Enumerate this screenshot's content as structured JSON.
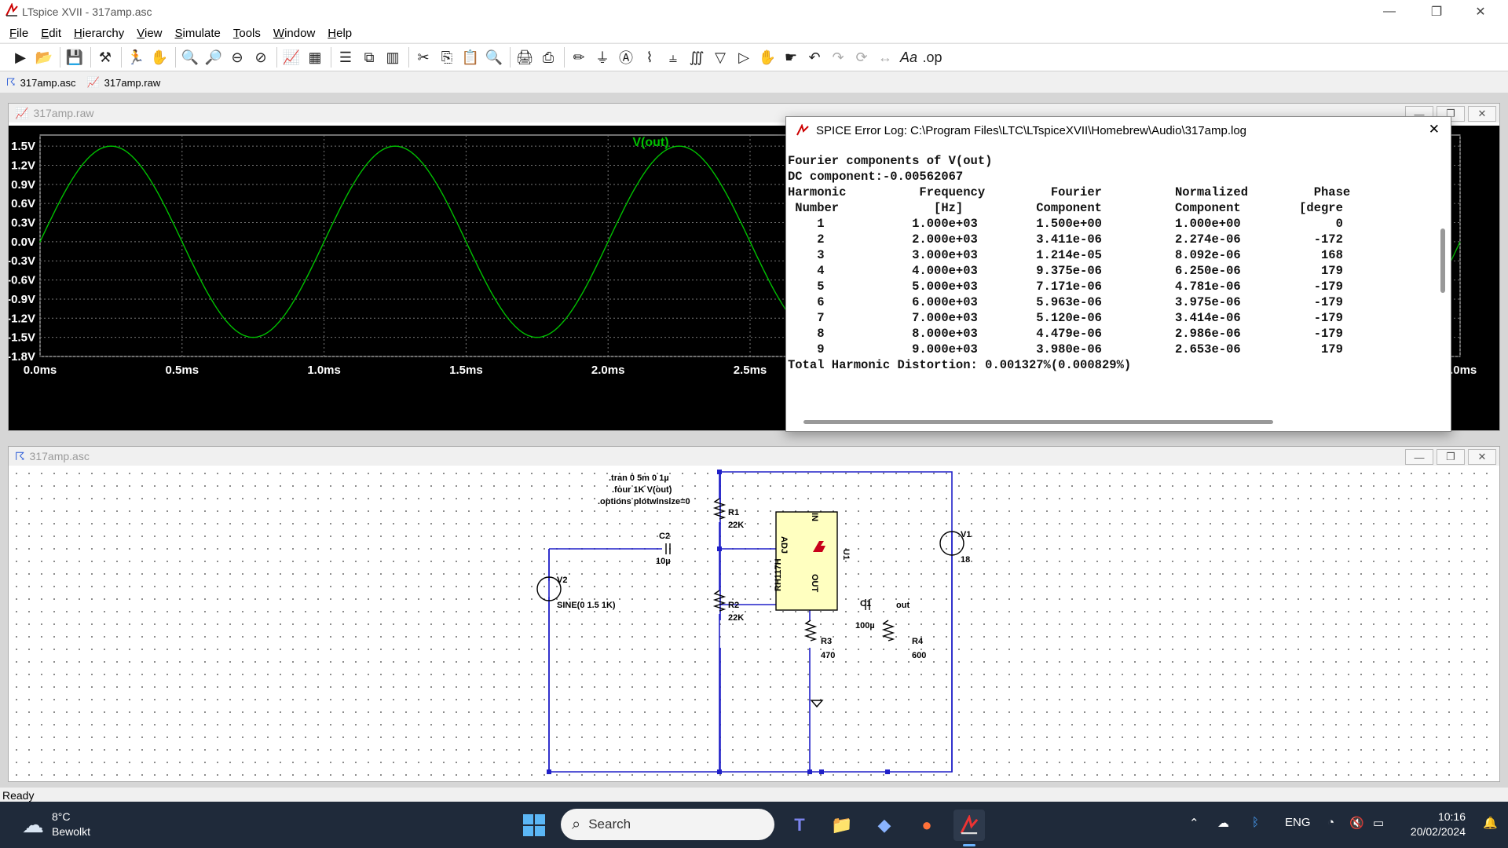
{
  "window": {
    "title": "LTspice XVII - 317amp.asc",
    "min_icon": "minimize-icon",
    "max_icon": "maximize-icon",
    "close_icon": "close-icon"
  },
  "menu": [
    "File",
    "Edit",
    "Hierarchy",
    "View",
    "Simulate",
    "Tools",
    "Window",
    "Help"
  ],
  "tabs": [
    {
      "label": "317amp.asc",
      "icon": "schematic-icon"
    },
    {
      "label": "317amp.raw",
      "icon": "waveform-icon"
    }
  ],
  "plot_window": {
    "title": "317amp.raw",
    "trace_label": "V(out)",
    "trace_color": "#00c000"
  },
  "chart_data": {
    "type": "line",
    "title": "",
    "xlabel": "",
    "ylabel": "",
    "series": [
      {
        "name": "V(out)",
        "x": [
          0,
          0.25,
          0.5,
          0.75,
          1.0,
          1.25,
          1.5,
          1.75,
          2.0,
          2.25,
          2.5,
          2.75,
          3.0
        ],
        "values": [
          0,
          1.5,
          0,
          -1.5,
          0,
          1.5,
          0,
          -1.5,
          0,
          1.5,
          0,
          -1.5,
          0
        ]
      }
    ],
    "xlim": [
      0,
      5
    ],
    "ylim": [
      -1.8,
      1.6
    ],
    "x_ticks": [
      "0.0ms",
      "0.5ms",
      "1.0ms",
      "1.5ms",
      "2.0ms",
      "2.5ms",
      "5.0ms"
    ],
    "y_ticks": [
      "1.5V",
      "1.2V",
      "0.9V",
      "0.6V",
      "0.3V",
      "0.0V",
      "-0.3V",
      "-0.6V",
      "-0.9V",
      "-1.2V",
      "-1.5V",
      "-1.8V"
    ],
    "grid": true,
    "background": "#000000"
  },
  "error_log": {
    "title": "SPICE Error Log: C:\\Program Files\\LTC\\LTspiceXVII\\Homebrew\\Audio\\317amp.log",
    "lines": [
      "Fourier components of V(out)",
      "DC component:-0.00562067",
      "",
      "Harmonic          Frequency         Fourier          Normalized         Phase",
      " Number             [Hz]          Component          Component        [degre",
      "    1            1.000e+03        1.500e+00          1.000e+00             0",
      "    2            2.000e+03        3.411e-06          2.274e-06          -172",
      "    3            3.000e+03        1.214e-05          8.092e-06           168",
      "    4            4.000e+03        9.375e-06          6.250e-06           179",
      "    5            5.000e+03        7.171e-06          4.781e-06          -179",
      "    6            6.000e+03        5.963e-06          3.975e-06          -179",
      "    7            7.000e+03        5.120e-06          3.414e-06          -179",
      "    8            8.000e+03        4.479e-06          2.986e-06          -179",
      "    9            9.000e+03        3.980e-06          2.653e-06           179",
      "Total Harmonic Distortion: 0.001327%(0.000829%)"
    ]
  },
  "schematic_window": {
    "title": "317amp.asc",
    "directives": [
      ".tran 0 5m 0 1µ",
      ".four 1K V(out)",
      ".options plotwinsize=0"
    ],
    "components": {
      "R1": {
        "name": "R1",
        "value": "22K"
      },
      "R2": {
        "name": "R2",
        "value": "22K"
      },
      "R3": {
        "name": "R3",
        "value": "470"
      },
      "R4": {
        "name": "R4",
        "value": "600"
      },
      "C1": {
        "name": "C1",
        "value": "100µ"
      },
      "C2": {
        "name": "C2",
        "value": "10µ"
      },
      "V1": {
        "name": "V1",
        "value": "18"
      },
      "V2": {
        "name": "V2",
        "value": "SINE(0 1.5 1K)"
      },
      "U1": {
        "name": "U1",
        "part": "RH117H",
        "pin_in": "IN",
        "pin_adj": "ADJ",
        "pin_out": "OUT"
      }
    },
    "net_label": "out"
  },
  "status": "Ready",
  "taskbar": {
    "temperature": "8°C",
    "condition": "Bewolkt",
    "search_placeholder": "Search",
    "language": "ENG",
    "time": "10:16",
    "date": "20/02/2024"
  }
}
